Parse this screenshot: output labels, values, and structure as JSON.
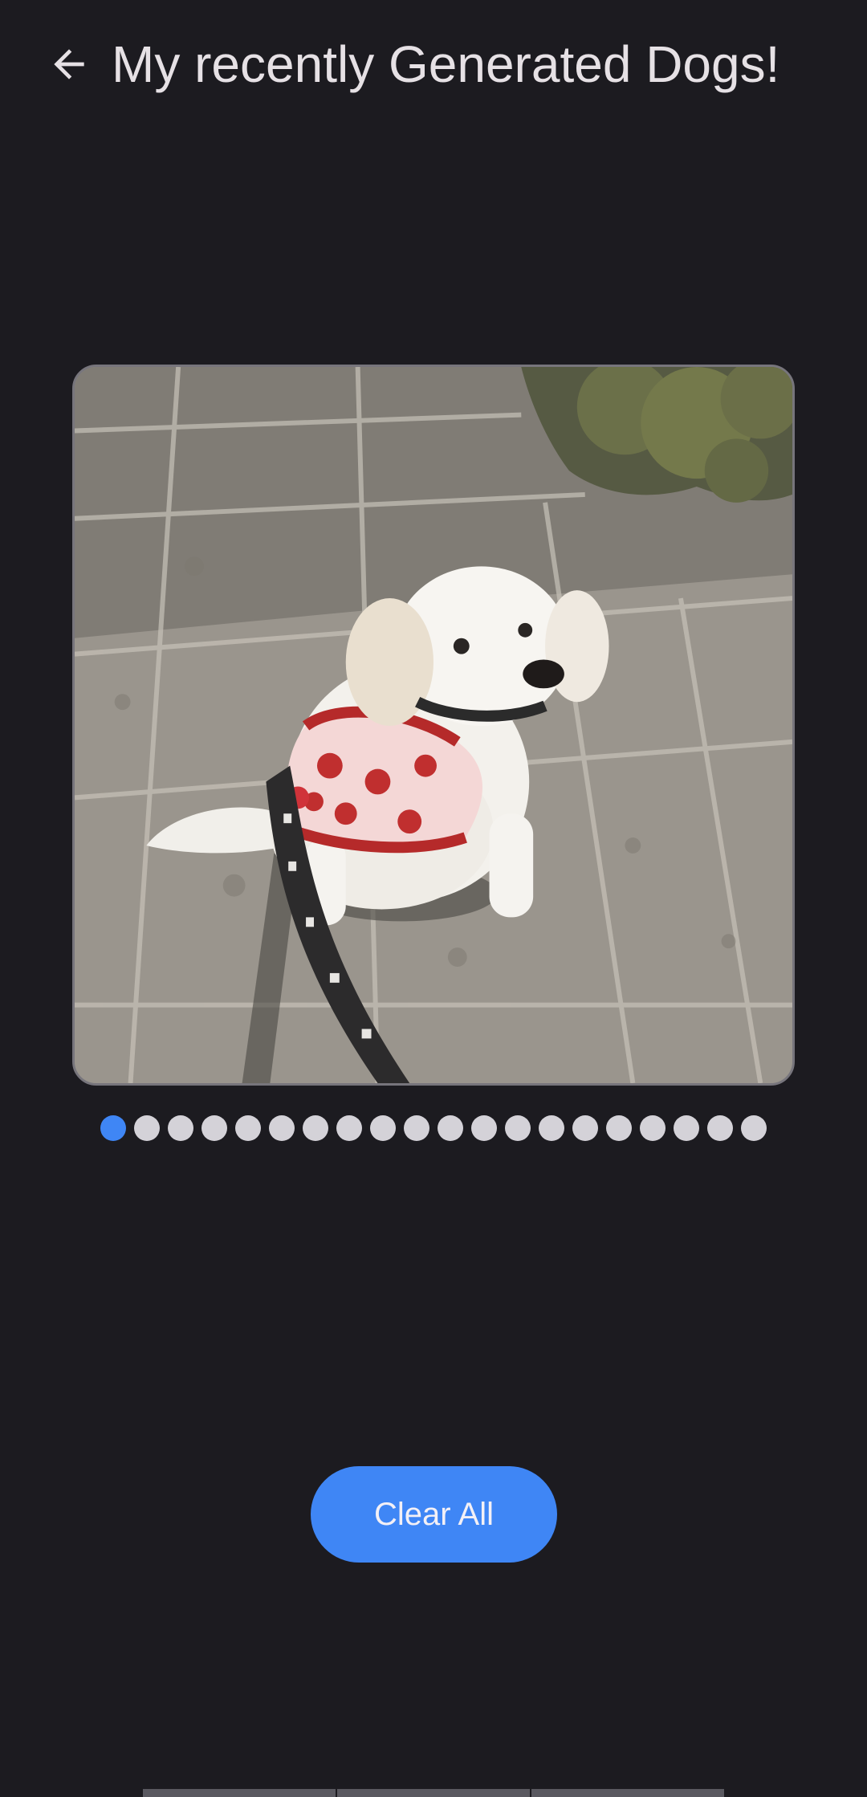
{
  "header": {
    "title": "My recently Generated Dogs!",
    "back_icon": "arrow-back-icon"
  },
  "carousel": {
    "image_description": "white fluffy dog in red ladybug harness sitting on paving stones",
    "page_count": 20,
    "current_page": 1
  },
  "actions": {
    "clear_all_label": "Clear All"
  },
  "colors": {
    "background": "#1c1b20",
    "accent": "#3f86f5",
    "indicator_inactive": "#d4d2d8",
    "text": "#e6e1e5"
  }
}
